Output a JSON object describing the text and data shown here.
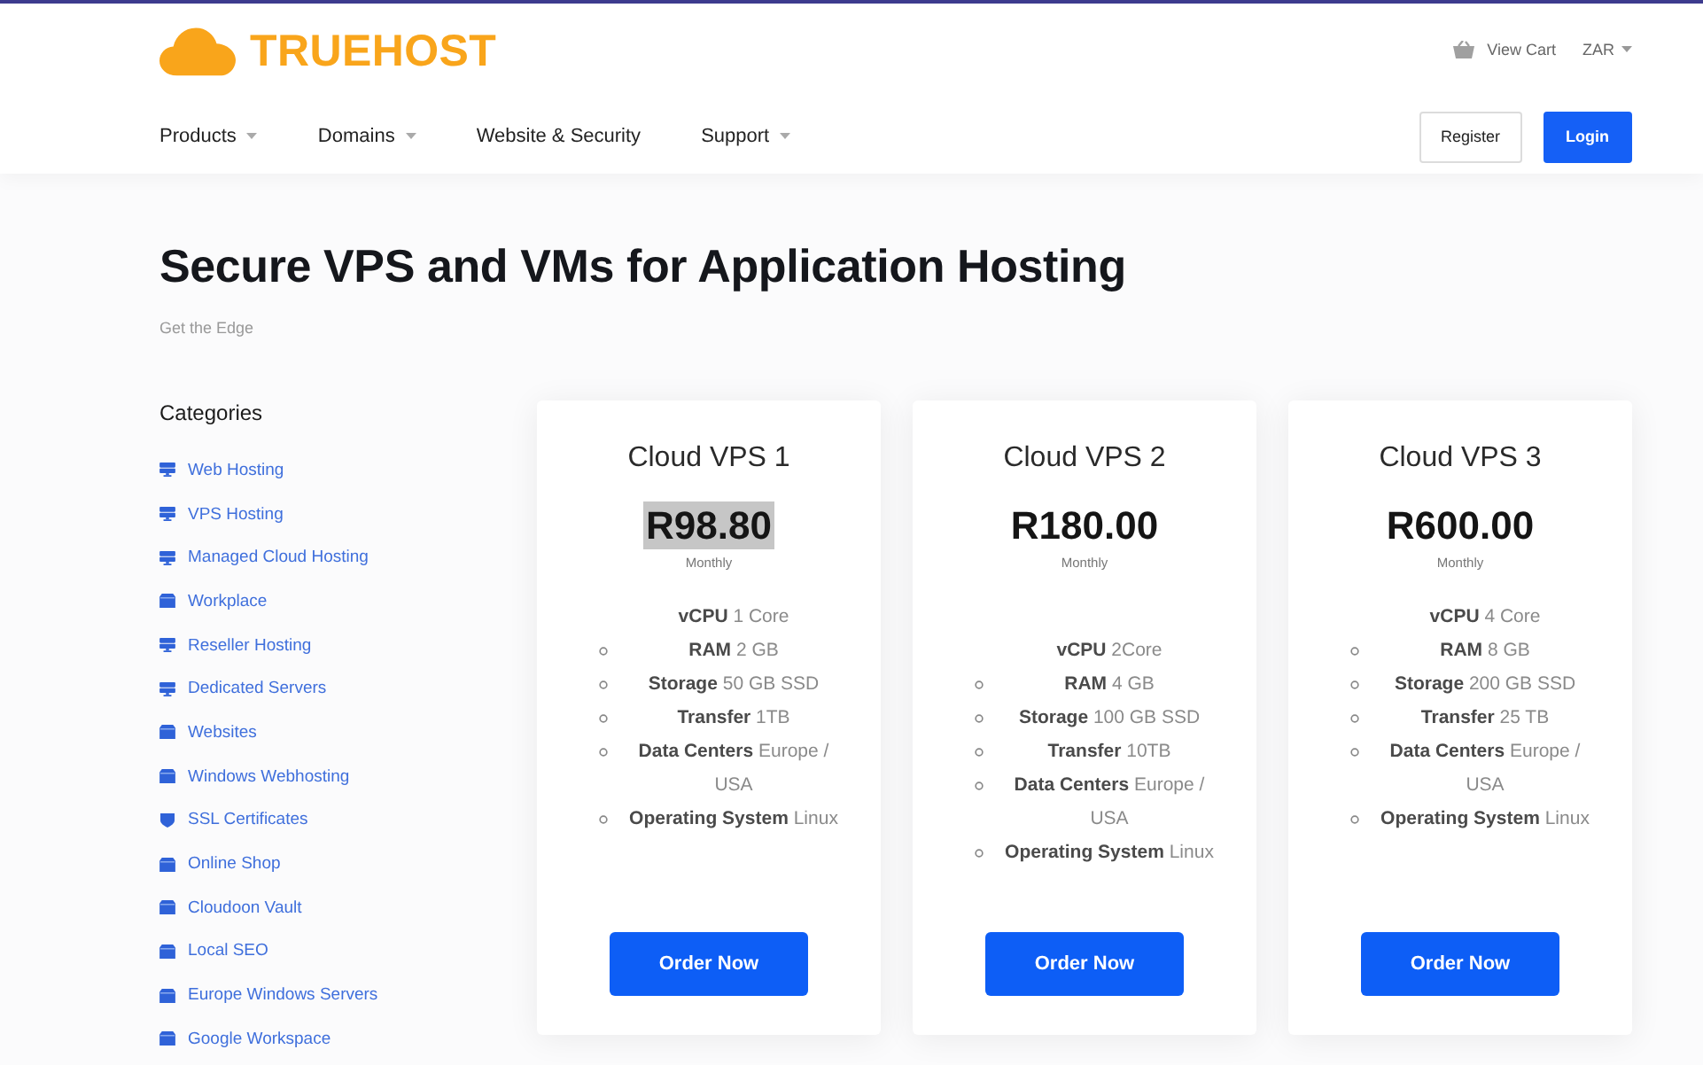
{
  "top_bar": {
    "logo": {
      "text": "TRUEHOST"
    },
    "cart": {
      "label": "View Cart"
    },
    "currency": {
      "label": "ZAR",
      "has_dropdown": true
    }
  },
  "nav": {
    "items": [
      {
        "label": "Products",
        "has_dropdown": true
      },
      {
        "label": "Domains",
        "has_dropdown": true
      },
      {
        "label": "Website & Security",
        "has_dropdown": false
      },
      {
        "label": "Support",
        "has_dropdown": true
      }
    ],
    "buttons": [
      {
        "label": "Register",
        "kind": "outline"
      },
      {
        "label": "Login",
        "kind": "primary"
      }
    ]
  },
  "heading": {
    "title": "Secure VPS and VMs for Application Hosting",
    "subtitle": "Get the Edge"
  },
  "sidebar": {
    "title": "Categories",
    "items": [
      {
        "label": "Web Hosting",
        "kind": "server"
      },
      {
        "label": "VPS Hosting",
        "kind": "server"
      },
      {
        "label": "Managed Cloud Hosting",
        "kind": "server"
      },
      {
        "label": "Workplace",
        "kind": "box"
      },
      {
        "label": "Reseller Hosting",
        "kind": "server"
      },
      {
        "label": "Dedicated Servers",
        "kind": "server"
      },
      {
        "label": "Websites",
        "kind": "box"
      },
      {
        "label": "Windows Webhosting",
        "kind": "box"
      },
      {
        "label": "SSL Certificates",
        "kind": "shield"
      },
      {
        "label": "Online Shop",
        "kind": "box"
      },
      {
        "label": "Cloudoon Vault",
        "kind": "box"
      },
      {
        "label": "Local SEO",
        "kind": "box"
      },
      {
        "label": "Europe Windows Servers",
        "kind": "box"
      },
      {
        "label": "Google Workspace",
        "kind": "box"
      }
    ]
  },
  "plans": [
    {
      "name": "Cloud VPS 1",
      "price": "R98.80",
      "price_highlighted": true,
      "period": "Monthly",
      "blank_line_before_specs": false,
      "lead_spec": {
        "label": "vCPU",
        "value": "1 Core"
      },
      "features": [
        {
          "label": "RAM",
          "value": "2 GB"
        },
        {
          "label": "Storage",
          "value": "50 GB SSD"
        },
        {
          "label": "Transfer",
          "value": "1TB"
        },
        {
          "label": "Data Centers",
          "value": "Europe / USA"
        },
        {
          "label": "Operating System",
          "value": "Linux"
        }
      ],
      "button": "Order Now"
    },
    {
      "name": "Cloud VPS 2",
      "price": "R180.00",
      "price_highlighted": false,
      "period": "Monthly",
      "blank_line_before_specs": true,
      "lead_spec": {
        "label": "vCPU",
        "value": "2Core"
      },
      "features": [
        {
          "label": "RAM",
          "value": "4 GB"
        },
        {
          "label": "Storage",
          "value": "100 GB SSD"
        },
        {
          "label": "Transfer",
          "value": "10TB"
        },
        {
          "label": "Data Centers",
          "value": "Europe / USA"
        },
        {
          "label": "Operating System",
          "value": "Linux"
        }
      ],
      "button": "Order Now"
    },
    {
      "name": "Cloud VPS 3",
      "price": "R600.00",
      "price_highlighted": false,
      "period": "Monthly",
      "blank_line_before_specs": false,
      "lead_spec": {
        "label": "vCPU",
        "value": "4 Core"
      },
      "features": [
        {
          "label": "RAM",
          "value": "8 GB"
        },
        {
          "label": "Storage",
          "value": "200 GB SSD"
        },
        {
          "label": "Transfer",
          "value": "25 TB"
        },
        {
          "label": "Data Centers",
          "value": "Europe / USA"
        },
        {
          "label": "Operating System",
          "value": "Linux"
        }
      ],
      "button": "Order Now"
    }
  ]
}
